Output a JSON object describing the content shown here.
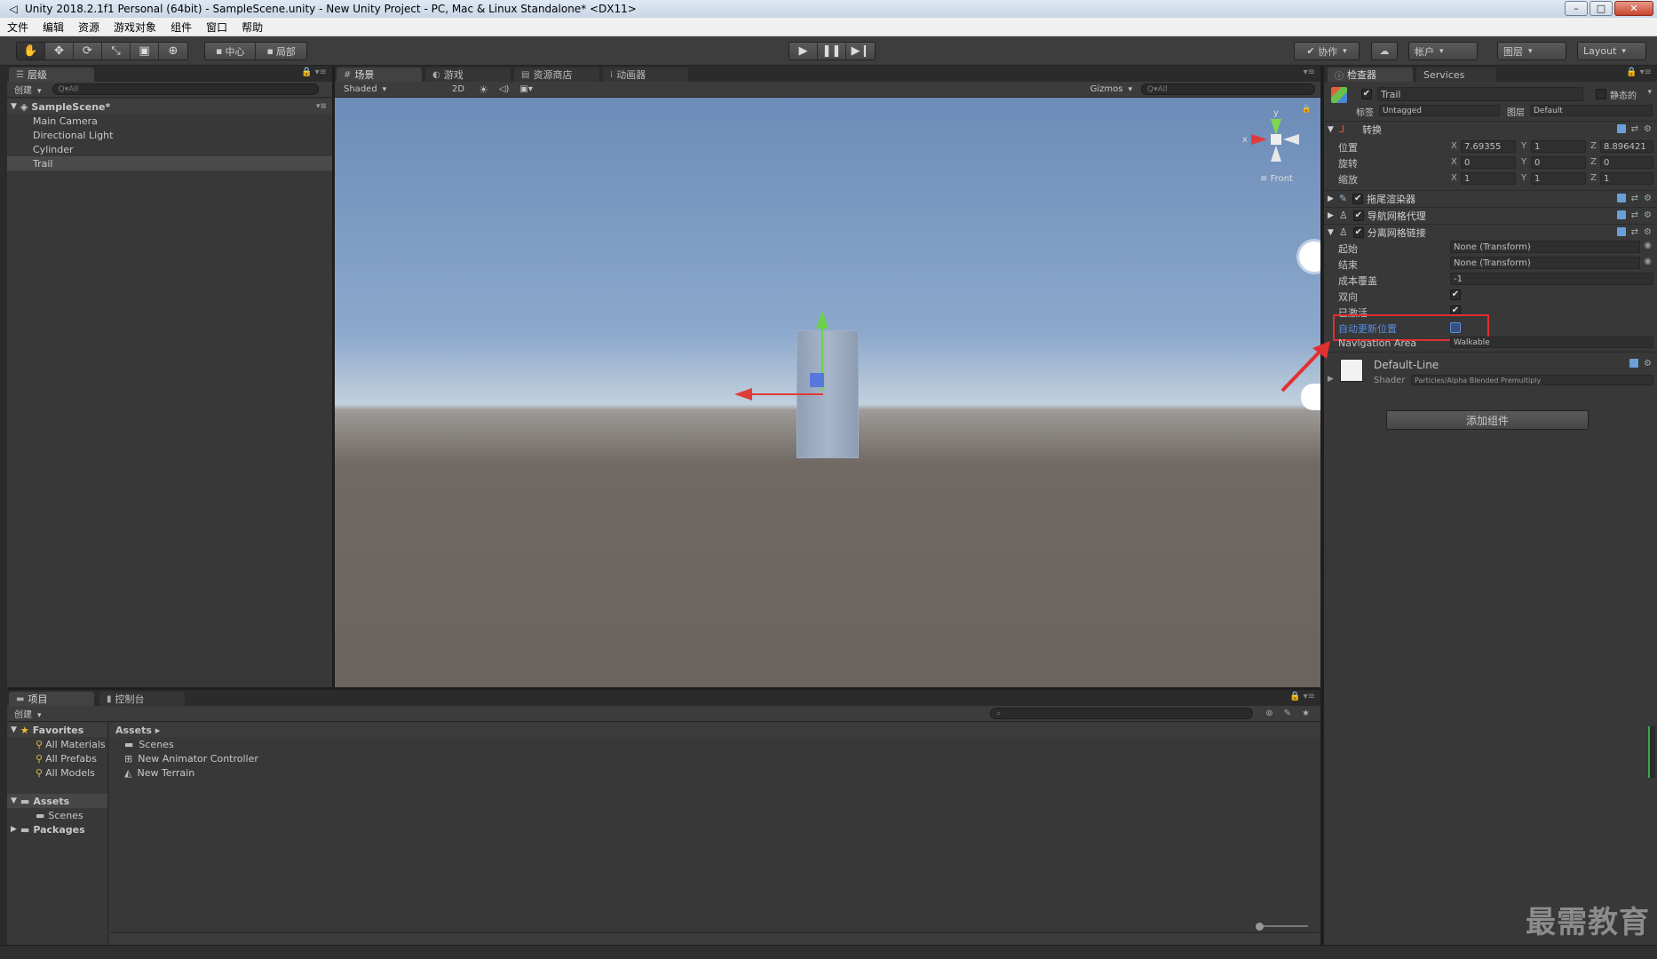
{
  "window": {
    "title": "Unity 2018.2.1f1 Personal (64bit) - SampleScene.unity - New Unity Project - PC, Mac & Linux Standalone* <DX11>"
  },
  "menu": [
    "文件",
    "编辑",
    "资源",
    "游戏对象",
    "组件",
    "窗口",
    "帮助"
  ],
  "toolbar": {
    "pivot": "中心",
    "space": "局部",
    "collab": "协作",
    "account": "帐户",
    "layers": "图层",
    "layout": "Layout"
  },
  "hierarchy": {
    "tab": "层级",
    "create": "创建",
    "search_placeholder": "Q▾All",
    "scene": "SampleScene*",
    "items": [
      "Main Camera",
      "Directional Light",
      "Cylinder",
      "Trail"
    ],
    "selected": "Trail"
  },
  "scene_tabs": [
    "场景",
    "游戏",
    "资源商店",
    "动画器"
  ],
  "scene_bar": {
    "shading": "Shaded",
    "mode2d": "2D",
    "gizmos": "Gizmos",
    "search_placeholder": "Q▾All"
  },
  "gizmo": {
    "y": "y",
    "x": "x",
    "view": "Front"
  },
  "inspector": {
    "tabs": [
      "检查器",
      "Services"
    ],
    "object_name": "Trail",
    "static": "静态的",
    "tag_label": "标签",
    "tag": "Untagged",
    "layer_label": "图层",
    "layer": "Default",
    "transform": {
      "title": "转换",
      "rows": [
        {
          "label": "位置",
          "x": "7.69355",
          "y": "1",
          "z": "8.896421"
        },
        {
          "label": "旋转",
          "x": "0",
          "y": "0",
          "z": "0"
        },
        {
          "label": "缩放",
          "x": "1",
          "y": "1",
          "z": "1"
        }
      ],
      "axis": [
        "X",
        "Y",
        "Z"
      ]
    },
    "components": [
      "拖尾渲染器",
      "导航网格代理",
      "分离网格链接"
    ],
    "offmesh": {
      "start_label": "起始",
      "start": "None (Transform)",
      "end_label": "结束",
      "end": "None (Transform)",
      "cost_label": "成本覆盖",
      "cost": "-1",
      "bidir_label": "双向",
      "active_label": "已激活",
      "autoupdate_label": "自动更新位置",
      "navarea_label": "Navigation Area",
      "navarea": "Walkable"
    },
    "material": {
      "name": "Default-Line",
      "shader_label": "Shader",
      "shader": "Particles/Alpha Blended Premultiply"
    },
    "add_component": "添加组件"
  },
  "project": {
    "tabs": [
      "项目",
      "控制台"
    ],
    "create": "创建",
    "favorites": "Favorites",
    "fav_items": [
      "All Materials",
      "All Prefabs",
      "All Models"
    ],
    "assets": "Assets",
    "assets_children": [
      "Scenes"
    ],
    "packages": "Packages",
    "breadcrumb": "Assets ▸",
    "files": [
      "Scenes",
      "New Animator Controller",
      "New Terrain"
    ]
  },
  "watermark": "最需教育",
  "colors": {
    "highlight": "#e03030",
    "link_blue": "#5a8de0"
  }
}
